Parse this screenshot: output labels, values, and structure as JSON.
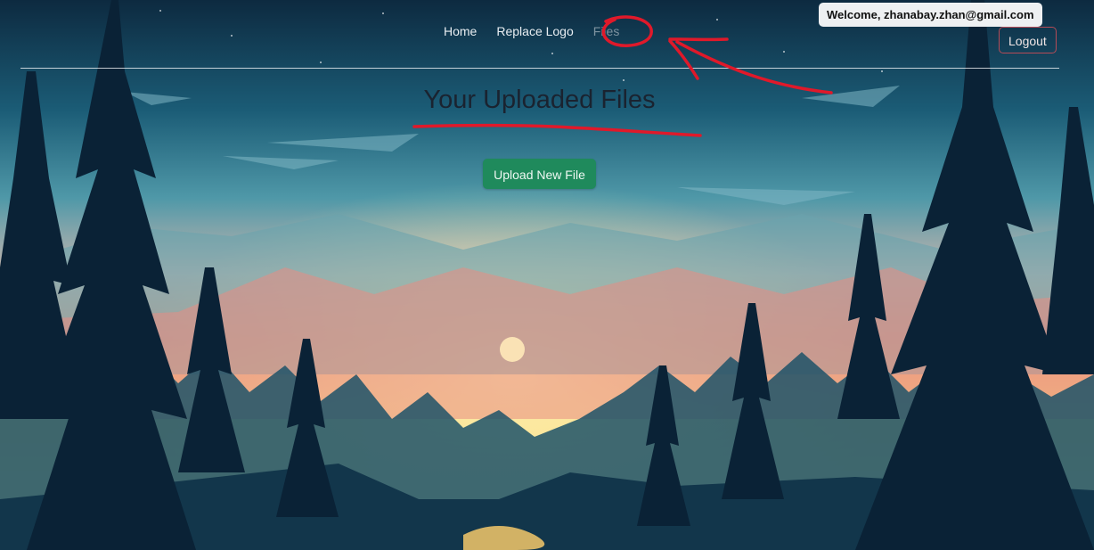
{
  "nav": {
    "items": [
      {
        "label": "Home",
        "active": false
      },
      {
        "label": "Replace Logo",
        "active": false
      },
      {
        "label": "Files",
        "active": true
      }
    ]
  },
  "user": {
    "welcome_text": "Welcome, zhanabay.zhan@gmail.com",
    "logout_label": "Logout"
  },
  "main": {
    "title": "Your Uploaded Files",
    "upload_button_label": "Upload New File"
  },
  "colors": {
    "accent_green": "#1f8a5c",
    "logout_border": "#b54b57",
    "annotation_red": "#e0192a"
  },
  "icons": [
    "arrow-annotation",
    "circle-annotation",
    "underline-annotation"
  ]
}
